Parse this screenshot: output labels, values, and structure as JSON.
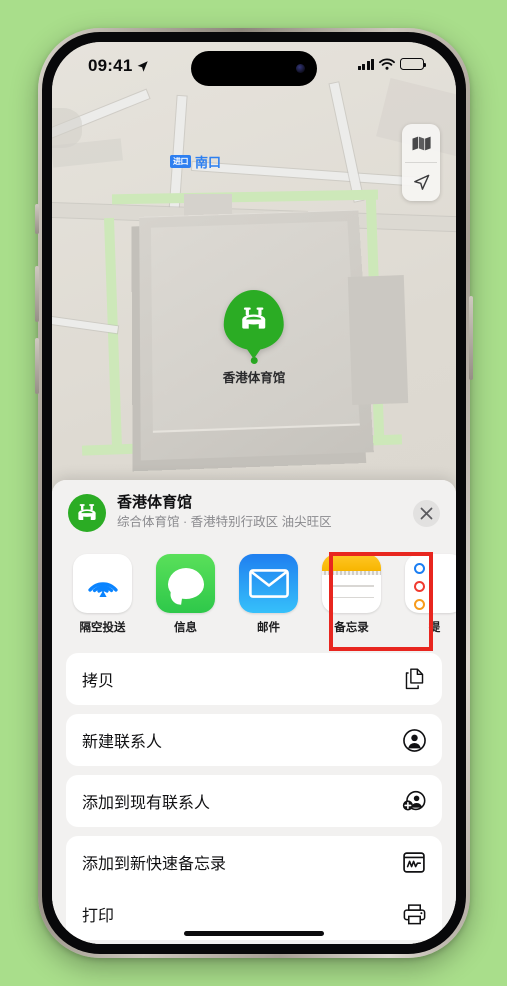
{
  "status_bar": {
    "time": "09:41",
    "location_arrow_icon": "location-arrow-icon",
    "signal_icon": "cellular-bars-icon",
    "wifi_icon": "wifi-icon",
    "battery_icon": "battery-full-icon"
  },
  "map": {
    "entrance_badge": "进口",
    "entrance_label": "南口",
    "pin_label": "香港体育馆",
    "pin_icon": "stadium-icon",
    "controls": {
      "map_type_icon": "folded-map-icon",
      "locate_icon": "location-arrow-icon"
    }
  },
  "share_sheet": {
    "place_icon": "stadium-icon",
    "place_title": "香港体育馆",
    "place_subtitle": "综合体育馆 · 香港特别行政区 油尖旺区",
    "close_icon": "close-icon",
    "apps": [
      {
        "label": "隔空投送",
        "icon": "airdrop-icon",
        "highlighted": false
      },
      {
        "label": "信息",
        "icon": "messages-icon",
        "highlighted": false
      },
      {
        "label": "邮件",
        "icon": "mail-icon",
        "highlighted": false
      },
      {
        "label": "备忘录",
        "icon": "notes-icon",
        "highlighted": true
      },
      {
        "label": "提",
        "icon": "reminders-icon",
        "highlighted": false
      }
    ],
    "actions": [
      {
        "label": "拷贝",
        "icon": "copy-icon"
      },
      {
        "label": "新建联系人",
        "icon": "person-circle-icon"
      },
      {
        "label": "添加到现有联系人",
        "icon": "person-add-circle-icon"
      },
      {
        "label": "添加到新快速备忘录",
        "icon": "quick-note-icon"
      },
      {
        "label": "打印",
        "icon": "printer-icon"
      }
    ]
  },
  "colors": {
    "background_green": "#a9de8b",
    "pin_green": "#2bac24",
    "highlight_red": "#e8261f",
    "map_label_blue": "#2d7ff0",
    "notes_yellow": "#f7b500"
  },
  "home_indicator": "home-indicator"
}
